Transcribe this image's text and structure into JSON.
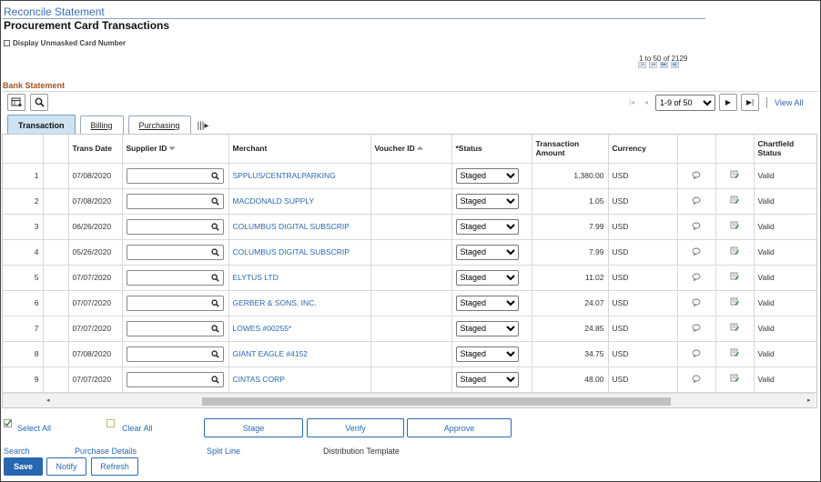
{
  "page": {
    "title": "Reconcile Statement",
    "subtitle": "Procurement Card Transactions",
    "unmask_label": "Display Unmasked Card Number",
    "record_count": "1 to 50 of 2129",
    "section_title": "Bank Statement"
  },
  "pager": {
    "range_selected": "1-9 of 50",
    "view_all": "View All"
  },
  "tabs": [
    {
      "label": "Transaction",
      "active": true
    },
    {
      "label": "Billing",
      "active": false
    },
    {
      "label": "Purchasing",
      "active": false
    }
  ],
  "columns": {
    "row": "",
    "trans_date": "Trans Date",
    "supplier_id": "Supplier ID",
    "merchant": "Merchant",
    "voucher_id": "Voucher ID",
    "status": "*Status",
    "amount": "Transaction Amount",
    "currency": "Currency",
    "comment": "",
    "distribution": "",
    "chartfield": "Chartfield Status"
  },
  "rows": [
    {
      "n": "1",
      "date": "07/08/2020",
      "merchant": "SPPLUS/CENTRALPARKING",
      "status": "Staged",
      "amount": "1,380.00",
      "currency": "USD",
      "chartfield": "Valid"
    },
    {
      "n": "2",
      "date": "07/08/2020",
      "merchant": "MACDONALD SUPPLY",
      "status": "Staged",
      "amount": "1.05",
      "currency": "USD",
      "chartfield": "Valid"
    },
    {
      "n": "3",
      "date": "06/26/2020",
      "merchant": "COLUMBUS DIGITAL SUBSCRIP",
      "status": "Staged",
      "amount": "7.99",
      "currency": "USD",
      "chartfield": "Valid"
    },
    {
      "n": "4",
      "date": "05/26/2020",
      "merchant": "COLUMBUS DIGITAL SUBSCRIP",
      "status": "Staged",
      "amount": "7.99",
      "currency": "USD",
      "chartfield": "Valid"
    },
    {
      "n": "5",
      "date": "07/07/2020",
      "merchant": "ELYTUS LTD",
      "status": "Staged",
      "amount": "11.02",
      "currency": "USD",
      "chartfield": "Valid"
    },
    {
      "n": "6",
      "date": "07/07/2020",
      "merchant": "GERBER & SONS, INC.",
      "status": "Staged",
      "amount": "24.07",
      "currency": "USD",
      "chartfield": "Valid"
    },
    {
      "n": "7",
      "date": "07/07/2020",
      "merchant": "LOWES #00255*",
      "status": "Staged",
      "amount": "24.85",
      "currency": "USD",
      "chartfield": "Valid"
    },
    {
      "n": "8",
      "date": "07/08/2020",
      "merchant": "GIANT EAGLE #4152",
      "status": "Staged",
      "amount": "34.75",
      "currency": "USD",
      "chartfield": "Valid"
    },
    {
      "n": "9",
      "date": "07/07/2020",
      "merchant": "CINTAS CORP",
      "status": "Staged",
      "amount": "48.00",
      "currency": "USD",
      "chartfield": "Valid"
    }
  ],
  "actions": {
    "select_all": "Select All",
    "clear_all": "Clear All",
    "stage": "Stage",
    "verify": "Verify",
    "approve": "Approve"
  },
  "links": {
    "search": "Search",
    "purchase_details": "Purchase Details",
    "split_line": "Split Line",
    "distribution_template": "Distribution Template"
  },
  "buttons": {
    "save": "Save",
    "notify": "Notify",
    "refresh": "Refresh"
  },
  "colors": {
    "link": "#2a67b1",
    "primary_button": "#2766b0",
    "section_title": "#a4541f",
    "active_tab": "#cfe2f4"
  }
}
